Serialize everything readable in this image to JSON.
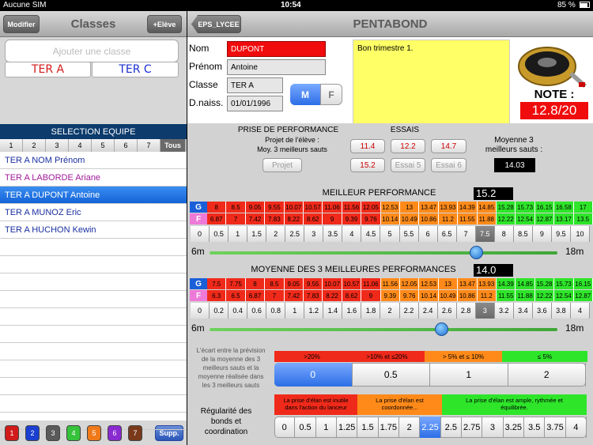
{
  "status": {
    "carrier": "Aucune SIM",
    "time": "10:54",
    "battery": "85 %"
  },
  "left": {
    "modify_label": "Modifier",
    "title": "Classes",
    "add_student_label": "+Elève",
    "add_class_label": "Ajouter une classe",
    "classes": [
      "TER A",
      "TER C"
    ],
    "team_header": "SELECTION EQUIPE",
    "team_tabs": [
      "1",
      "2",
      "3",
      "4",
      "5",
      "6",
      "7",
      "Tous"
    ],
    "students": [
      {
        "name": "TER A NOM Prénom",
        "color": "#1a2fa0"
      },
      {
        "name": "TER A LABORDE Ariane",
        "color": "#a01a9a"
      },
      {
        "name": "TER A DUPONT Antoine",
        "color": "#ffffff",
        "selected": true
      },
      {
        "name": "TER A MUNOZ Eric",
        "color": "#1a2fa0"
      },
      {
        "name": "TER A HUCHON Kewin",
        "color": "#1a2fa0"
      }
    ],
    "color_buttons": [
      {
        "label": "1",
        "color": "#d11a1a"
      },
      {
        "label": "2",
        "color": "#1a3fd1"
      },
      {
        "label": "3",
        "color": "#5a5a5a"
      },
      {
        "label": "4",
        "color": "#36c23a"
      },
      {
        "label": "5",
        "color": "#f07a1a"
      },
      {
        "label": "6",
        "color": "#8a2ad1"
      },
      {
        "label": "7",
        "color": "#7a3a1a"
      }
    ],
    "supp_label": "Supp."
  },
  "right": {
    "back_label": "EPS_LYCEE",
    "title": "PENTABOND",
    "student": {
      "nom_label": "Nom",
      "nom": "DUPONT",
      "prenom_label": "Prénom",
      "prenom": "Antoine",
      "classe_label": "Classe",
      "classe": "TER A",
      "dnaiss_label": "D.naiss.",
      "dnaiss": "01/01/1996",
      "gender_m": "M",
      "gender_f": "F"
    },
    "comment": "Bon trimestre 1.",
    "note_label": "NOTE :",
    "note_value": "12.8/20",
    "perf": {
      "header": "PRISE DE PERFORMANCE",
      "projet_text": "Projet de l'élève :\nMoy. 3 meilleurs sauts",
      "projet_btn": "Projet",
      "essais_header": "ESSAIS",
      "essais": [
        "11.4",
        "12.2",
        "14.7",
        "15.2",
        "Essai 5",
        "Essai 6"
      ],
      "moyenne_label": "Moyenne 3\nmeilleurs sauts :",
      "moyenne_value": "14.03"
    },
    "best": {
      "title": "MEILLEUR PERFORMANCE",
      "value": "15.2",
      "g_label": "G",
      "f_label": "F",
      "g_values": [
        "8",
        "8.5",
        "9.05",
        "9.55",
        "10.07",
        "10.57",
        "11.06",
        "11.56",
        "12.05",
        "12.53",
        "13",
        "13.47",
        "13.93",
        "14.39",
        "14.85",
        "15.28",
        "15.73",
        "16.15",
        "16.58",
        "17"
      ],
      "f_values": [
        "6.87",
        "7",
        "7.42",
        "7.83",
        "8.22",
        "8.62",
        "9",
        "9.39",
        "9.76",
        "10.14",
        "10.49",
        "10.86",
        "11.2",
        "11.55",
        "11.88",
        "12.22",
        "12.54",
        "12.87",
        "13.17",
        "13.5"
      ],
      "scale": [
        "0",
        "0.5",
        "1",
        "1.5",
        "2",
        "2.5",
        "3",
        "3.5",
        "4",
        "4.5",
        "5",
        "5.5",
        "6",
        "6.5",
        "7",
        "7.5",
        "8",
        "8.5",
        "9",
        "9.5",
        "10"
      ],
      "scale_selected": "7.5",
      "min_label": "6m",
      "max_label": "18m",
      "slider_value": 15.2
    },
    "avg": {
      "title": "MOYENNE DES 3 MEILLEURES PERFORMANCES",
      "value": "14.0",
      "g_label": "G",
      "f_label": "F",
      "g_values": [
        "7.5",
        "7.75",
        "8",
        "8.5",
        "9.05",
        "9.55",
        "10.07",
        "10.57",
        "11.06",
        "11.56",
        "12.05",
        "12.53",
        "13",
        "13.47",
        "13.93",
        "14.39",
        "14.85",
        "15.28",
        "15.73",
        "16.15"
      ],
      "f_values": [
        "6.3",
        "6.5",
        "6.87",
        "7",
        "7.42",
        "7.83",
        "8.22",
        "8.62",
        "9",
        "9.39",
        "9.76",
        "10.14",
        "10.49",
        "10.86",
        "11.2",
        "11.55",
        "11.88",
        "12.22",
        "12.54",
        "12.87"
      ],
      "scale": [
        "0",
        "0.2",
        "0.4",
        "0.6",
        "0.8",
        "1",
        "1.2",
        "1.4",
        "1.6",
        "1.8",
        "2",
        "2.2",
        "2.4",
        "2.6",
        "2.8",
        "3",
        "3.2",
        "3.4",
        "3.6",
        "3.8",
        "4"
      ],
      "scale_selected": "3",
      "min_label": "6m",
      "max_label": "18m",
      "slider_value": 14.0
    },
    "ecart": {
      "text": "L'écart entre la prévision\nde la moyenne des 3\nmeilleurs sauts et la\nmoyenne réalisée dans\nles 3 meilleurs sauts",
      "bands": [
        ">20%",
        ">10% et ≤20%",
        "> 5% et ≤ 10%",
        "≤ 5%"
      ],
      "options": [
        "0",
        "0.5",
        "1",
        "2"
      ],
      "selected": "0"
    },
    "regularite": {
      "label": "Régularité des\nbonds et\ncoordination",
      "bands": [
        "La prise d'élan est inutile\ndans l'action du lanceur",
        "La prise d'élan est\ncoordonnée...",
        "La prise d'élan est ample, rythmée et\néquilibrée."
      ],
      "options": [
        "0",
        "0.5",
        "1",
        "1.25",
        "1.5",
        "1.75",
        "2",
        "2.25",
        "2.5",
        "2.75",
        "3",
        "3.25",
        "3.5",
        "3.75",
        "4"
      ],
      "selected": "2.25"
    }
  }
}
